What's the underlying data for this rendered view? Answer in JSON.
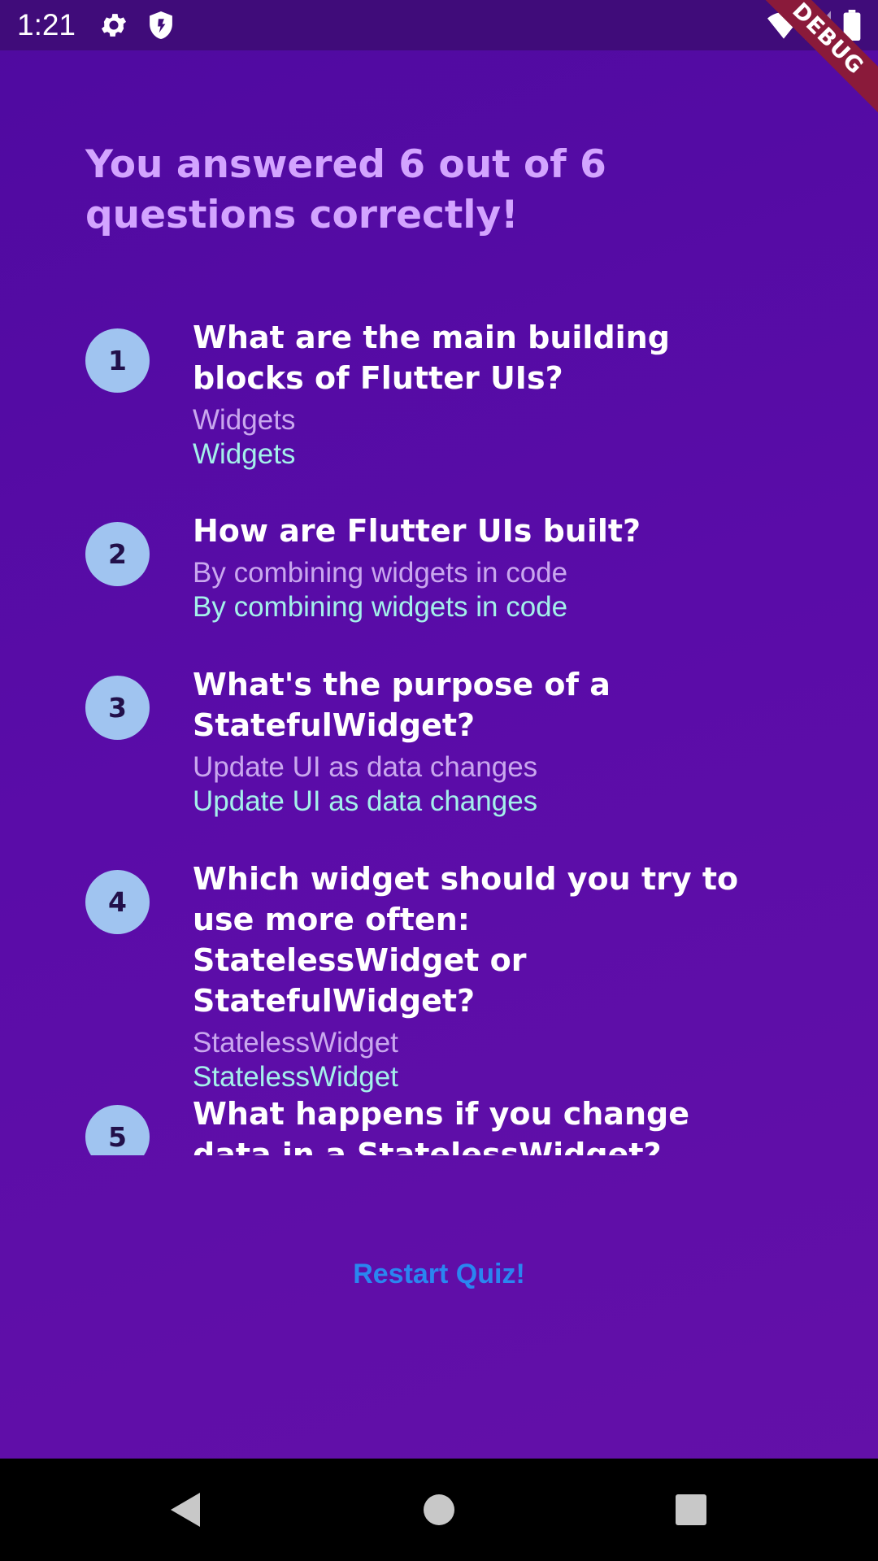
{
  "status_bar": {
    "time": "1:21"
  },
  "debug_banner": "DEBUG",
  "result_title": "You answered 6 out of 6 questions correctly!",
  "summary": [
    {
      "index": "1",
      "question": "What are the main building blocks of Flutter UIs?",
      "user_answer": "Widgets",
      "correct_answer": "Widgets"
    },
    {
      "index": "2",
      "question": "How are Flutter UIs built?",
      "user_answer": "By combining widgets in code",
      "correct_answer": "By combining widgets in code"
    },
    {
      "index": "3",
      "question": "What's the purpose of a StatefulWidget?",
      "user_answer": "Update UI as data changes",
      "correct_answer": "Update UI as data changes"
    },
    {
      "index": "4",
      "question": "Which widget should you try to use more often: StatelessWidget or StatefulWidget?",
      "user_answer": "StatelessWidget",
      "correct_answer": "StatelessWidget"
    },
    {
      "index": "5",
      "question": "What happens if you change data in a StatelessWidget?",
      "user_answer": "",
      "correct_answer": ""
    }
  ],
  "restart_label": "Restart Quiz!",
  "colors": {
    "background": "#5a0ca8",
    "title": "#d3a4ff",
    "index_circle": "#a0c4f0",
    "user_answer": "#c9a7ee",
    "correct_answer": "#a4f0ea",
    "restart": "#2a86f0"
  }
}
